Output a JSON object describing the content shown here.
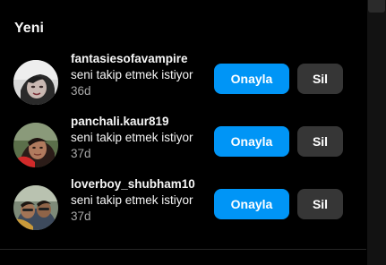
{
  "section": {
    "title": "Yeni"
  },
  "requests": [
    {
      "username": "fantasiesofavampire",
      "message": "seni takip etmek istiyor",
      "time": "36d",
      "confirm_label": "Onayla",
      "delete_label": "Sil"
    },
    {
      "username": "panchali.kaur819",
      "message": "seni takip etmek istiyor",
      "time": "37d",
      "confirm_label": "Onayla",
      "delete_label": "Sil"
    },
    {
      "username": "loverboy_shubham10",
      "message": "seni takip etmek istiyor",
      "time": "37d",
      "confirm_label": "Onayla",
      "delete_label": "Sil"
    }
  ],
  "colors": {
    "background": "#000000",
    "primary_text": "#f5f5f5",
    "secondary_text": "#a8a8a8",
    "confirm_button": "#0095f6",
    "delete_button": "#363636"
  }
}
